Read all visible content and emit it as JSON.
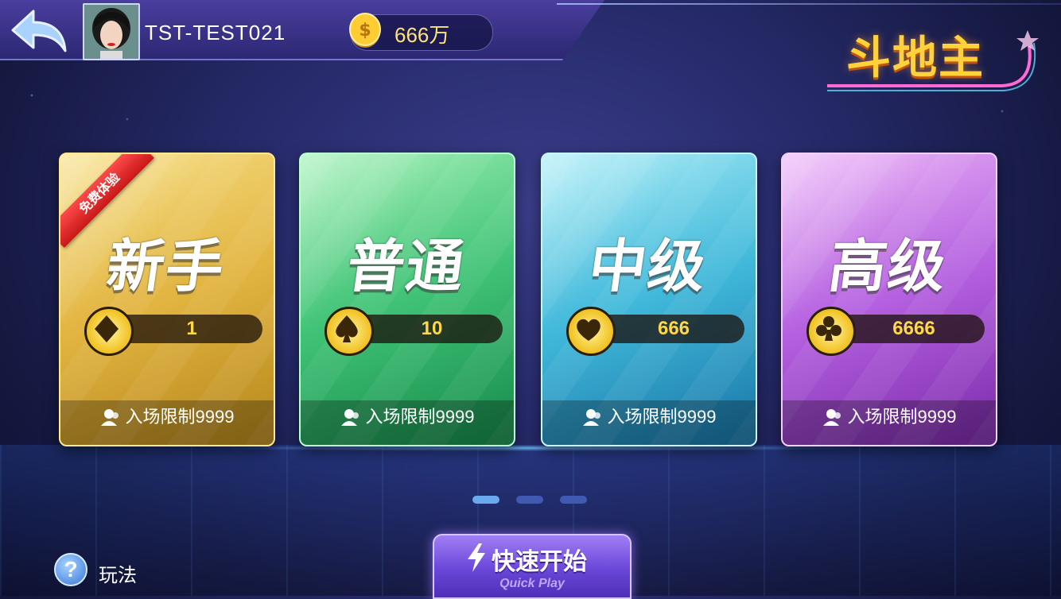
{
  "header": {
    "username": "TST-TEST021",
    "coins": "666万",
    "game_title": "斗地主"
  },
  "rooms": [
    {
      "tier": "新手",
      "ribbon": "免费体验",
      "suit": "diamond",
      "bet": "1",
      "limit": "入场限制9999",
      "accent": "#e2b440"
    },
    {
      "tier": "普通",
      "suit": "spade",
      "bet": "10",
      "limit": "入场限制9999",
      "accent": "#3fc276"
    },
    {
      "tier": "中级",
      "suit": "heart",
      "bet": "666",
      "limit": "入场限制9999",
      "accent": "#40b8da"
    },
    {
      "tier": "高级",
      "suit": "club",
      "bet": "6666",
      "limit": "入场限制9999",
      "accent": "#b460e0"
    }
  ],
  "pagination": {
    "pages": 3,
    "current": 1
  },
  "footer": {
    "help_label": "玩法",
    "quick_play_label": "快速开始",
    "quick_play_sub": "Quick Play"
  },
  "icons": [
    "back-arrow-icon",
    "coin-icon",
    "diamond-icon",
    "spade-icon",
    "heart-icon",
    "club-icon",
    "person-icon",
    "help-icon",
    "lightning-icon"
  ]
}
